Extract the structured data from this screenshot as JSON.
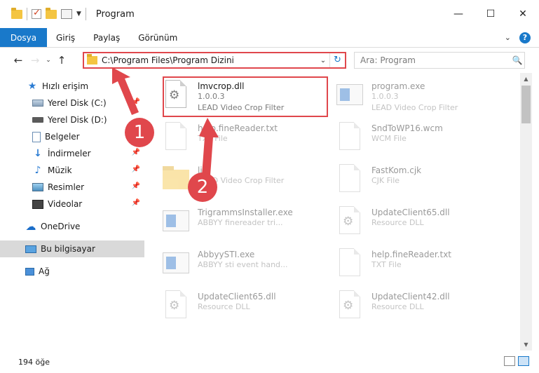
{
  "window": {
    "title": "Program",
    "minimize": "—",
    "maximize": "☐",
    "close": "✕"
  },
  "ribbon": {
    "tabs": [
      "Dosya",
      "Giriş",
      "Paylaş",
      "Görünüm"
    ],
    "expand": "⌄",
    "help": "?"
  },
  "nav": {
    "back": "←",
    "forward": "→",
    "recent": "⌄",
    "up": "↑",
    "address": "C:\\Program Files\\Program Dizini",
    "address_dropdown": "⌄",
    "refresh": "↻",
    "search_placeholder": "Ara: Program",
    "search_icon": "🔍"
  },
  "sidebar": {
    "items": [
      {
        "label": "Hızlı erişim",
        "icon": "star-icon"
      },
      {
        "label": "Yerel Disk (C:)",
        "icon": "drive-icon",
        "pinned": true
      },
      {
        "label": "Yerel Disk (D:)",
        "icon": "drive-icon"
      },
      {
        "label": "Belgeler",
        "icon": "document-icon",
        "pinned": true
      },
      {
        "label": "İndirmeler",
        "icon": "download-icon",
        "pinned": true
      },
      {
        "label": "Müzik",
        "icon": "music-icon",
        "pinned": true
      },
      {
        "label": "Resimler",
        "icon": "pictures-icon",
        "pinned": true
      },
      {
        "label": "Videolar",
        "icon": "videos-icon",
        "pinned": true
      },
      {
        "label": "OneDrive",
        "icon": "cloud-icon"
      },
      {
        "label": "Bu bilgisayar",
        "icon": "computer-icon",
        "selected": true
      },
      {
        "label": "Ağ",
        "icon": "network-icon"
      }
    ]
  },
  "files": [
    {
      "name": "lmvcrop.dll",
      "line1": "1.0.0.3",
      "line2": "LEAD Video Crop Filter",
      "icon": "dll-gear-icon",
      "highlighted": true
    },
    {
      "name": "program.exe",
      "line1": "1.0.0.3",
      "line2": "LEAD Video Crop Filter",
      "icon": "exe-icon",
      "dim": true
    },
    {
      "name": "help.fineReader.txt",
      "line1": "TXT File",
      "icon": "txt-icon",
      "dim": true
    },
    {
      "name": "SndToWP16.wcm",
      "line1": "WCM File",
      "icon": "file-icon",
      "dim": true
    },
    {
      "name": "lib",
      "line1": "LEAD Video Crop Filter",
      "icon": "folder-icon",
      "dim": true
    },
    {
      "name": "FastKom.cjk",
      "line1": "CJK File",
      "icon": "file-icon",
      "dim": true
    },
    {
      "name": "TrigrammsInstaller.exe",
      "line1": "ABBYY finereader tri...",
      "icon": "exe-icon",
      "dim": true
    },
    {
      "name": "UpdateClient65.dll",
      "line1": "Resource DLL",
      "icon": "dll-gear-icon",
      "dim": true
    },
    {
      "name": "AbbyySTI.exe",
      "line1": "ABBYY sti event hand...",
      "icon": "exe-icon",
      "dim": true
    },
    {
      "name": "help.fineReader.txt",
      "line1": "TXT File",
      "icon": "txt-icon",
      "dim": true
    },
    {
      "name": "UpdateClient65.dll",
      "line1": "Resource DLL",
      "icon": "dll-gear-icon",
      "dim": true
    },
    {
      "name": "UpdateClient42.dll",
      "line1": "Resource DLL",
      "icon": "dll-gear-icon",
      "dim": true
    }
  ],
  "status": {
    "count": "194 öğe"
  },
  "annotations": {
    "badge1": "1",
    "badge2": "2",
    "color": "#e0474c"
  },
  "colors": {
    "accent": "#1979ca",
    "highlight": "#e0474c"
  }
}
